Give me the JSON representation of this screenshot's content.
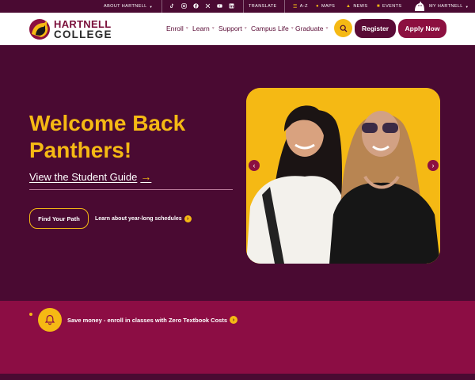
{
  "topbar": {
    "about": "ABOUT HARTNELL",
    "translate": "TRANSLATE",
    "a_z": "A-Z",
    "maps": "MAPS",
    "news": "NEWS",
    "events": "EVENTS",
    "my_hartnell": "MY HARTNELL",
    "social_icons": [
      "tiktok-icon",
      "instagram-icon",
      "facebook-icon",
      "x-icon",
      "youtube-icon",
      "linkedin-icon"
    ]
  },
  "header": {
    "logo_line1": "HARTNELL",
    "logo_line2": "COLLEGE",
    "nav": [
      "Enroll",
      "Learn",
      "Support",
      "Campus Life",
      "Graduate"
    ],
    "register": "Register",
    "apply": "Apply Now"
  },
  "hero": {
    "title": "Welcome Back Panthers!",
    "guide_link": "View the Student Guide",
    "find_path": "Find Your Path",
    "schedules_link": "Learn about year-long schedules"
  },
  "alert": {
    "text": "Save money - enroll in classes with Zero Textbook Costs"
  },
  "colors": {
    "maroon": "#4a0a32",
    "brand_red": "#8c1040",
    "gold": "#f5b914"
  }
}
